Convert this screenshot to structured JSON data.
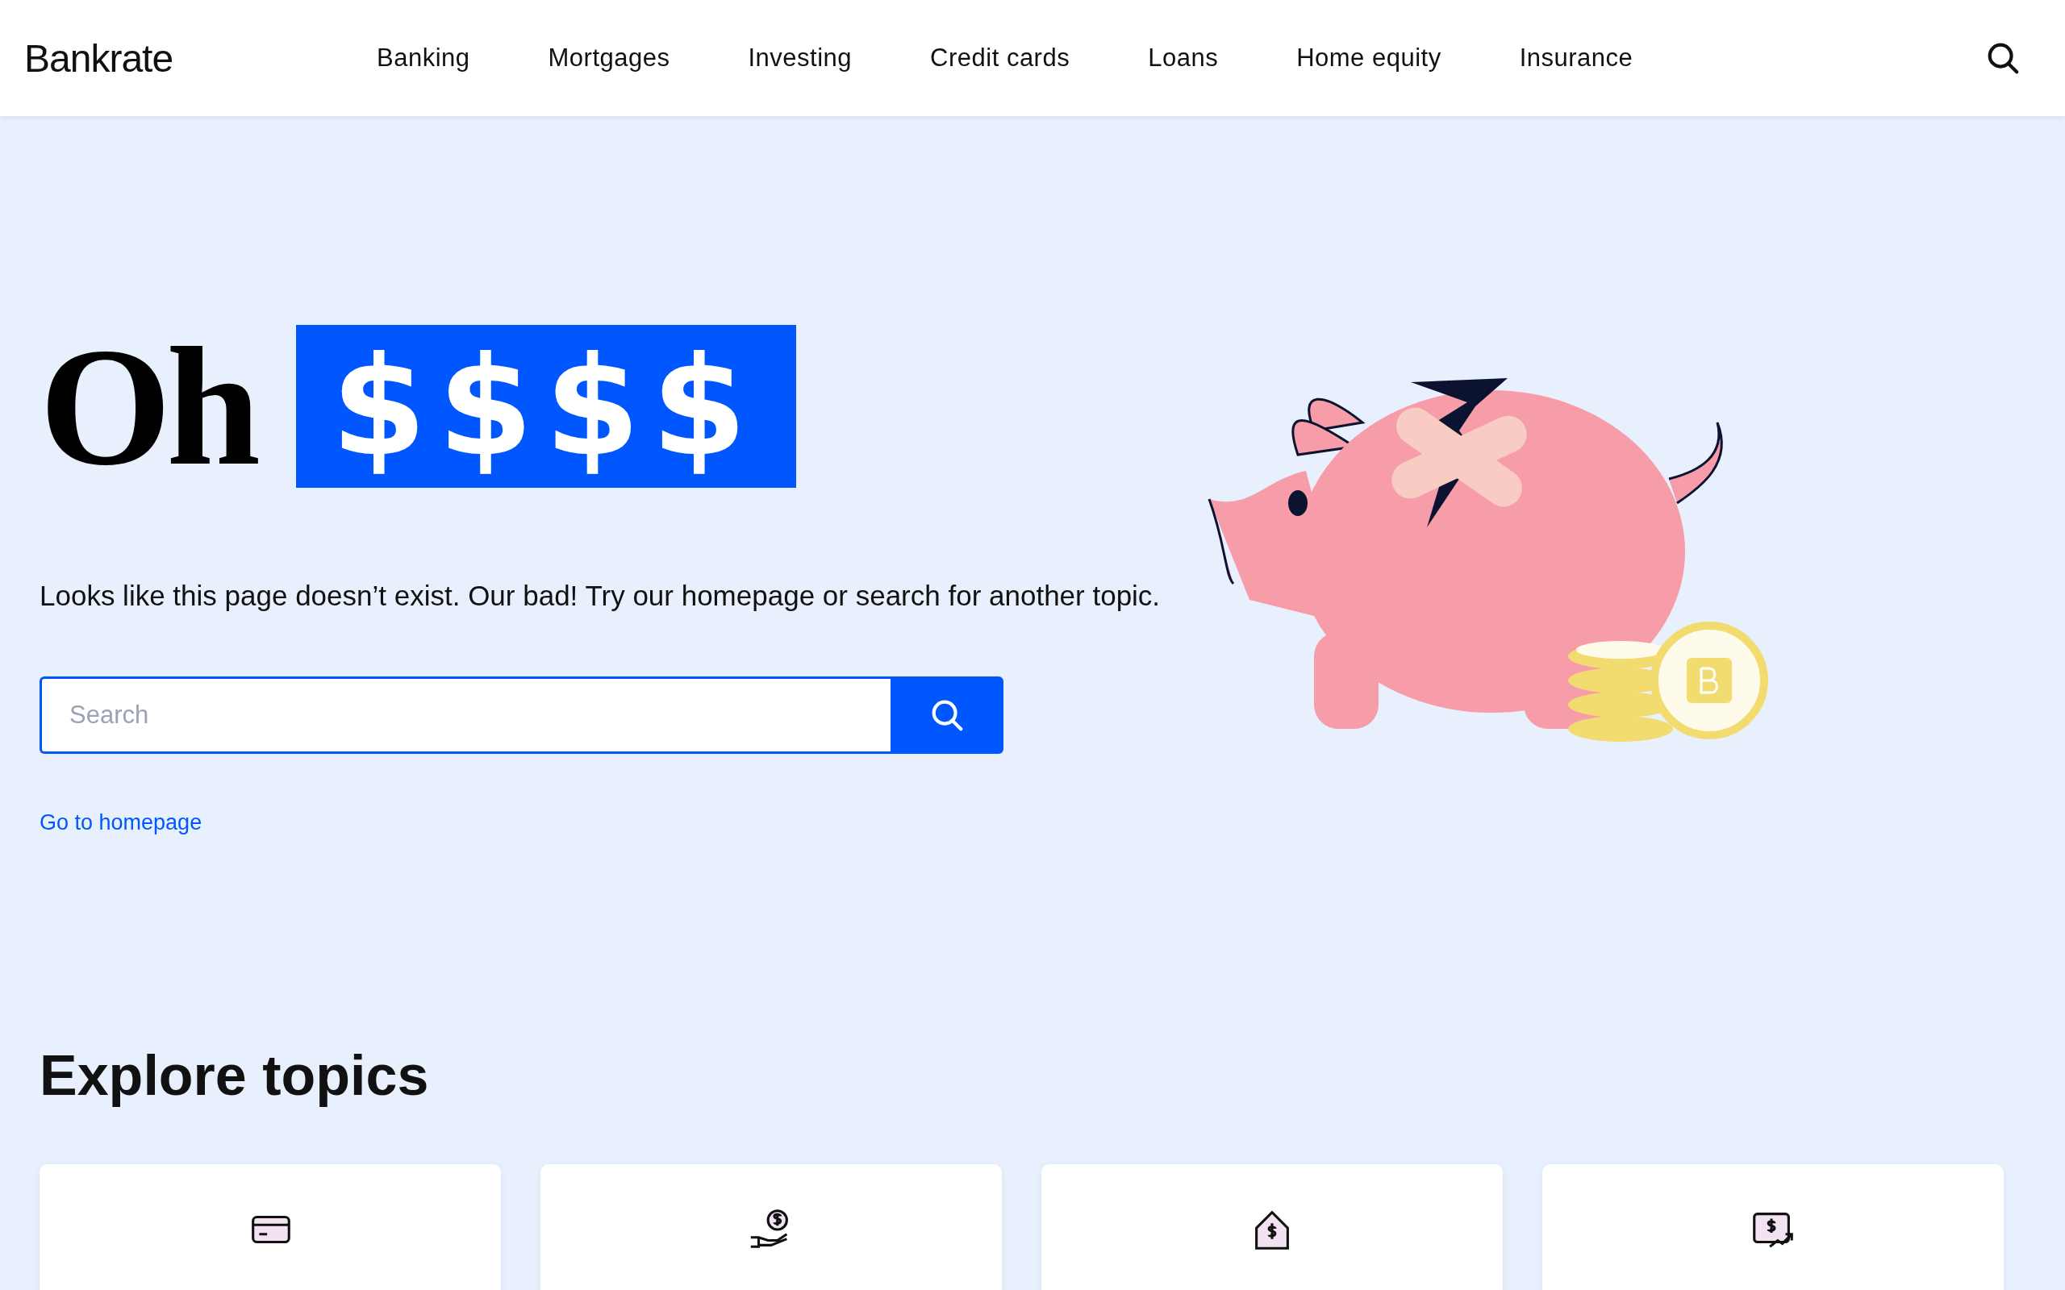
{
  "header": {
    "logo": "Bankrate",
    "nav": [
      "Banking",
      "Mortgages",
      "Investing",
      "Credit cards",
      "Loans",
      "Home equity",
      "Insurance"
    ]
  },
  "hero": {
    "heading": "Oh",
    "highlight": "$$$$",
    "message": "Looks like this page doesn’t exist. Our bad! Try our homepage or search for another topic.",
    "search": {
      "placeholder": "Search"
    },
    "link": "Go to homepage"
  },
  "topics": {
    "title": "Explore topics",
    "cards": [
      {
        "kind": "card"
      },
      {
        "kind": "loan"
      },
      {
        "kind": "home"
      },
      {
        "kind": "investing"
      }
    ]
  }
}
